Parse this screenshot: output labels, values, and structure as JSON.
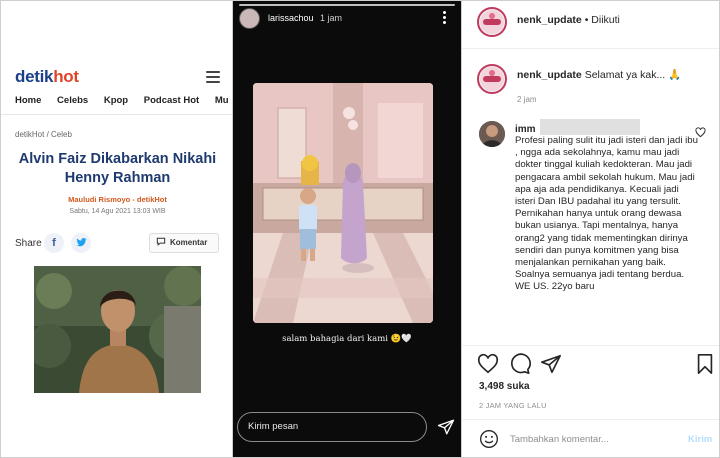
{
  "detik": {
    "logo_part1": "detik",
    "logo_part2": "hot",
    "nav": [
      "Home",
      "Celebs",
      "Kpop",
      "Podcast Hot",
      "Mu"
    ],
    "breadcrumb": "detikHot / Celeb",
    "headline": "Alvin Faiz Dikabarkan Nikahi Henny Rahman",
    "author": "Mauludi Rismoyo - detikHot",
    "date": "Sabtu, 14 Agu 2021 13:03 WIB",
    "share_label": "Share",
    "facebook_glyph": "f",
    "comment_button": "Komentar"
  },
  "story": {
    "username": "larissachou",
    "time": "1 jam",
    "caption": "salam bahagia dari kami 😉🤍",
    "message_placeholder": "Kirim pesan"
  },
  "post": {
    "account": "nenk_update",
    "follow_status": "• Diikuti",
    "owner_comment": "Selamat ya kak... 🙏",
    "owner_comment_time": "2 jam",
    "commenter": "imm",
    "comment_text": "Profesi paling sulit itu jadi isteri dan jadi ibu , ngga ada sekolahnya, kamu mau jadi dokter tinggal kuliah kedokteran. Mau jadi pengacara ambil sekolah hukum. Mau jadi apa aja ada pendidikanya. Kecuali jadi isteri Dan IBU padahal itu yang tersulit. Pernikahan hanya untuk orang dewasa bukan usianya. Tapi mentalnya, hanya orang2 yang tidak mementingkan dirinya sendiri dan punya komitmen yang bisa menjalankan pernikahan yang baik. Soalnya semuanya jadi tentang berdua. WE US. 22yo baru",
    "likes": "3,498 suka",
    "posted_ago": "2 JAM YANG LALU",
    "add_comment_placeholder": "Tambahkan komentar...",
    "send_label": "Kirim"
  }
}
